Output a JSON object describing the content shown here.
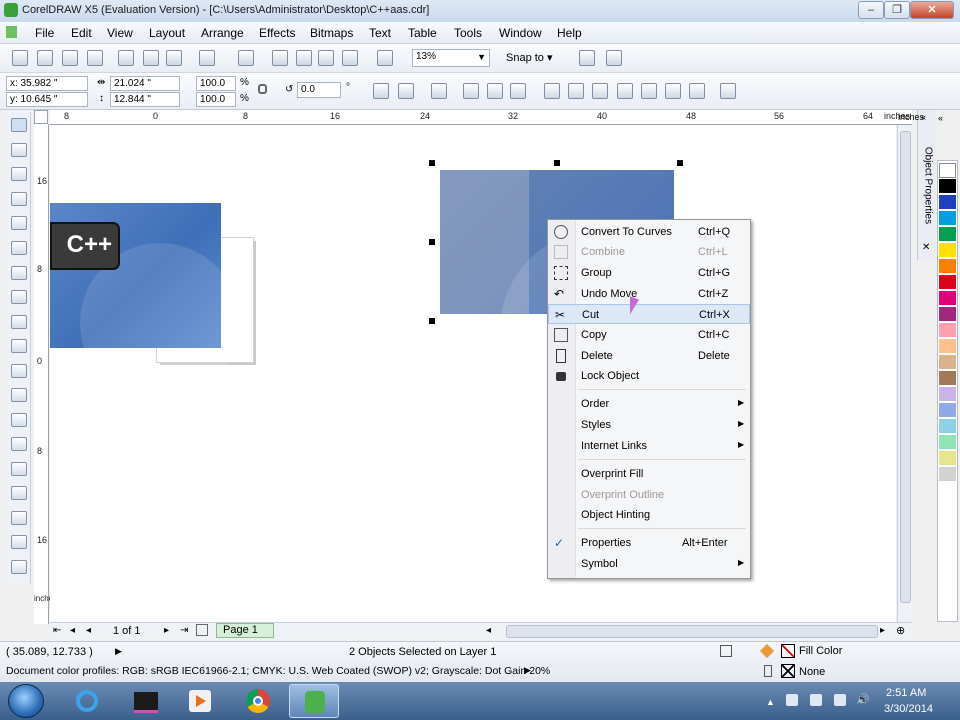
{
  "window": {
    "title": "CorelDRAW X5 (Evaluation Version) - [C:\\Users\\Administrator\\Desktop\\C++aas.cdr]",
    "min_glyph": "–",
    "max_glyph": "❐",
    "close_glyph": "✕"
  },
  "menubar": {
    "items": [
      "File",
      "Edit",
      "View",
      "Layout",
      "Arrange",
      "Effects",
      "Bitmaps",
      "Text",
      "Table",
      "Tools",
      "Window",
      "Help"
    ]
  },
  "toolbar": {
    "zoom_value": "13%",
    "snap_label": "Snap to"
  },
  "property_bar": {
    "x": "x: 35.982 \"",
    "y": "y: 10.645 \"",
    "width": "21.024 \"",
    "height": "12.844 \"",
    "scale_x": "100.0",
    "scale_y": "100.0",
    "percent": "%",
    "rotation": "0.0",
    "degree": "°"
  },
  "ruler": {
    "top_labels": [
      "8",
      "0",
      "8",
      "16",
      "24",
      "32",
      "40",
      "48",
      "56",
      "64"
    ],
    "unit": "inches",
    "left_labels": [
      "16",
      "8",
      "0",
      "8",
      "16"
    ],
    "left_unit": "inches"
  },
  "canvas": {
    "cpp_label": "C++",
    "cpp_bg": "#3f6fb8"
  },
  "docker": {
    "tab_label": "Object Properties"
  },
  "palette": {
    "colors": [
      "#ffffff",
      "#000000",
      "#1f3fbf",
      "#00a0e0",
      "#00a050",
      "#ffe000",
      "#ff8000",
      "#e00020",
      "#e0007a",
      "#a0287f",
      "#ff9fb0",
      "#ffc08f",
      "#d9b38c",
      "#a0785a",
      "#c8b4e6",
      "#8fa8e6",
      "#8fd0e6",
      "#8fe6b4",
      "#e6e68f",
      "#d2d2d2"
    ]
  },
  "context_menu": {
    "items": [
      {
        "label": "Convert To Curves",
        "shortcut": "Ctrl+Q",
        "icon": "convert-curves-icon",
        "disabled": false
      },
      {
        "label": "Combine",
        "shortcut": "Ctrl+L",
        "icon": "combine-icon",
        "disabled": true
      },
      {
        "label": "Group",
        "shortcut": "Ctrl+G",
        "icon": "group-icon",
        "disabled": false
      },
      {
        "label": "Undo Move",
        "shortcut": "Ctrl+Z",
        "icon": "undo-icon",
        "disabled": false
      },
      {
        "label": "Cut",
        "shortcut": "Ctrl+X",
        "icon": "scissors-icon",
        "disabled": false
      },
      {
        "label": "Copy",
        "shortcut": "Ctrl+C",
        "icon": "copy-icon",
        "disabled": false
      },
      {
        "label": "Delete",
        "shortcut": "Delete",
        "icon": "trash-icon",
        "disabled": false
      },
      {
        "label": "Lock Object",
        "shortcut": "",
        "icon": "lock-icon",
        "disabled": false
      }
    ],
    "group2": [
      {
        "label": "Order",
        "submenu": true
      },
      {
        "label": "Styles",
        "submenu": true
      },
      {
        "label": "Internet Links",
        "submenu": true
      }
    ],
    "group3": [
      {
        "label": "Overprint Fill",
        "disabled": false
      },
      {
        "label": "Overprint Outline",
        "disabled": true
      },
      {
        "label": "Object Hinting",
        "disabled": false
      }
    ],
    "group4": [
      {
        "label": "Properties",
        "shortcut": "Alt+Enter",
        "checked": true
      },
      {
        "label": "Symbol",
        "submenu": true
      }
    ],
    "checkmark": "✓",
    "submenu_arrow": "▶"
  },
  "page_nav": {
    "count": "1 of 1",
    "page_tab": "Page 1"
  },
  "status": {
    "cursor_pos": "( 35.089, 12.733 )",
    "selection": "2 Objects Selected on Layer 1",
    "profiles": "Document color profiles: RGB: sRGB IEC61966-2.1; CMYK: U.S. Web Coated (SWOP) v2; Grayscale: Dot Gain 20%",
    "fill_label": "Fill Color",
    "outline_label": "None"
  },
  "taskbar": {
    "time": "2:51 AM",
    "date": "3/30/2014"
  }
}
